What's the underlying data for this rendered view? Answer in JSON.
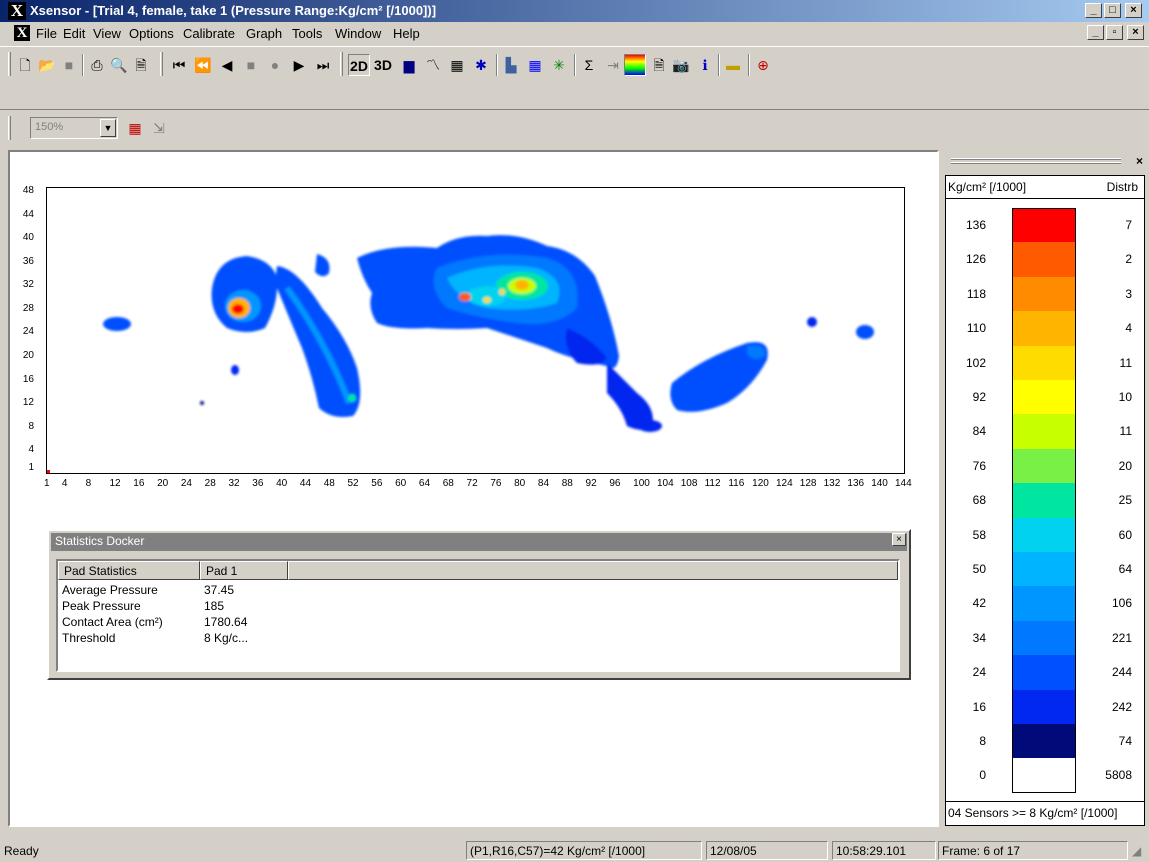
{
  "window": {
    "title": "Xsensor - [Trial 4, female, take 1  (Pressure Range:Kg/cm² [/1000])]",
    "app_icon_letter": "X"
  },
  "menu": [
    "File",
    "Edit",
    "View",
    "Options",
    "Calibrate",
    "Graph",
    "Tools",
    "Window",
    "Help"
  ],
  "toolbar": {
    "btn_2d": "2D",
    "btn_3d": "3D",
    "zoom_value": "150%"
  },
  "plot": {
    "y_ticks": [
      "48",
      "44",
      "40",
      "36",
      "32",
      "28",
      "24",
      "20",
      "16",
      "12",
      "8",
      "4",
      "1"
    ],
    "x_ticks": [
      "1",
      "4",
      "8",
      "12",
      "16",
      "20",
      "24",
      "28",
      "32",
      "36",
      "40",
      "44",
      "48",
      "52",
      "56",
      "60",
      "64",
      "68",
      "72",
      "76",
      "80",
      "84",
      "88",
      "92",
      "96",
      "100",
      "104",
      "108",
      "112",
      "116",
      "120",
      "124",
      "128",
      "132",
      "136",
      "140",
      "144"
    ]
  },
  "stats": {
    "title": "Statistics Docker",
    "col1": "Pad Statistics",
    "col2": "Pad 1",
    "rows": [
      {
        "label": "Average Pressure",
        "value": "37.45"
      },
      {
        "label": "Peak Pressure",
        "value": "185"
      },
      {
        "label": "Contact Area (cm²)",
        "value": "1780.64"
      },
      {
        "label": "Threshold",
        "value": "8 Kg/c..."
      }
    ]
  },
  "legend": {
    "header_units": "Kg/cm² [/1000]",
    "header_dist": "Distrb",
    "rows": [
      {
        "value": "136",
        "dist": "7",
        "color": "#ff0000"
      },
      {
        "value": "126",
        "dist": "2",
        "color": "#ff5a00"
      },
      {
        "value": "118",
        "dist": "3",
        "color": "#ff8c00"
      },
      {
        "value": "110",
        "dist": "4",
        "color": "#ffb400"
      },
      {
        "value": "102",
        "dist": "11",
        "color": "#ffdc00"
      },
      {
        "value": "92",
        "dist": "10",
        "color": "#ffff00"
      },
      {
        "value": "84",
        "dist": "11",
        "color": "#c8ff00"
      },
      {
        "value": "76",
        "dist": "20",
        "color": "#78f046"
      },
      {
        "value": "68",
        "dist": "25",
        "color": "#00e6a0"
      },
      {
        "value": "58",
        "dist": "60",
        "color": "#00d2f0"
      },
      {
        "value": "50",
        "dist": "64",
        "color": "#00b4ff"
      },
      {
        "value": "42",
        "dist": "106",
        "color": "#0096ff"
      },
      {
        "value": "34",
        "dist": "221",
        "color": "#0078ff"
      },
      {
        "value": "24",
        "dist": "244",
        "color": "#0050ff"
      },
      {
        "value": "16",
        "dist": "242",
        "color": "#0028f0"
      },
      {
        "value": "8",
        "dist": "74",
        "color": "#000a78"
      },
      {
        "value": "0",
        "dist": "5808",
        "color": "#ffffff"
      }
    ],
    "footer": "04 Sensors >= 8 Kg/cm² [/1000]"
  },
  "status": {
    "ready": "Ready",
    "cell_reading": "(P1,R16,C57)=42 Kg/cm² [/1000]",
    "date": "12/08/05",
    "time": "10:58:29.101",
    "frame": "Frame: 6 of 17"
  }
}
